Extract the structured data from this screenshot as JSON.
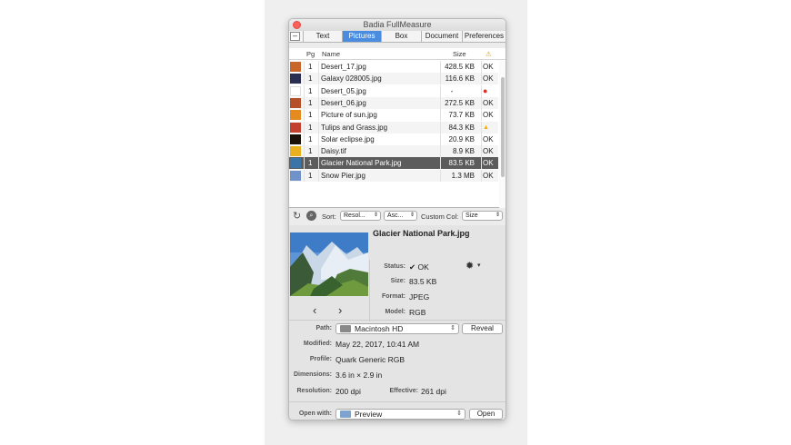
{
  "window": {
    "title": "Badia FullMeasure"
  },
  "tabs": [
    {
      "label": "Text",
      "active": false
    },
    {
      "label": "Pictures",
      "active": true
    },
    {
      "label": "Box",
      "active": false
    },
    {
      "label": "Document",
      "active": false
    },
    {
      "label": "Preferences",
      "active": false
    }
  ],
  "list": {
    "columns": {
      "pg": "Pg",
      "name": "Name",
      "size": "Size",
      "status": "⚠"
    },
    "rows": [
      {
        "pg": "1",
        "name": "Desert_17.jpg",
        "size": "428.5 KB",
        "status": "OK",
        "thumb": "#c9662a"
      },
      {
        "pg": "1",
        "name": "Galaxy 028005.jpg",
        "size": "116.6 KB",
        "status": "OK",
        "thumb": "#2a2f52"
      },
      {
        "pg": "1",
        "name": "Desert_05.jpg",
        "size": "-",
        "status": "●",
        "thumb": "#ffffff"
      },
      {
        "pg": "1",
        "name": "Desert_06.jpg",
        "size": "272.5 KB",
        "status": "OK",
        "thumb": "#b5502a"
      },
      {
        "pg": "1",
        "name": "Picture of sun.jpg",
        "size": "73.7 KB",
        "status": "OK",
        "thumb": "#e58a1e"
      },
      {
        "pg": "1",
        "name": "Tulips and Grass.jpg",
        "size": "84.3 KB",
        "status": "▲",
        "thumb": "#c2412f"
      },
      {
        "pg": "1",
        "name": "Solar eclipse.jpg",
        "size": "20.9 KB",
        "status": "OK",
        "thumb": "#1a1208"
      },
      {
        "pg": "1",
        "name": "Daisy.tif",
        "size": "8.9 KB",
        "status": "OK",
        "thumb": "#e9b020"
      },
      {
        "pg": "1",
        "name": "Glacier National Park.jpg",
        "size": "83.5 KB",
        "status": "OK",
        "thumb": "#3b75a8"
      },
      {
        "pg": "1",
        "name": "Snow Pier.jpg",
        "size": "1.3 MB",
        "status": "OK",
        "thumb": "#6f93c8"
      }
    ],
    "selected_index": 8
  },
  "toolbar": {
    "sort_label": "Sort:",
    "sort_value": "Resol...",
    "order_value": "Asc...",
    "custom_col_label": "Custom Col:",
    "custom_col_value": "Size"
  },
  "detail": {
    "file_name": "Glacier National Park.jpg",
    "status_label": "Status:",
    "status_value": "✔ OK",
    "size_label": "Size:",
    "size_value": "83.5 KB",
    "format_label": "Format:",
    "format_value": "JPEG",
    "model_label": "Model:",
    "model_value": "RGB",
    "path_label": "Path:",
    "path_value": "Macintosh HD",
    "reveal_button": "Reveal",
    "modified_label": "Modified:",
    "modified_value": "May 22, 2017, 10:41 AM",
    "profile_label": "Profile:",
    "profile_value": "Quark Generic RGB",
    "dimensions_label": "Dimensions:",
    "dimensions_value": "3.6 in × 2.9 in",
    "resolution_label": "Resolution:",
    "resolution_value": "200 dpi",
    "effective_label": "Effective:",
    "effective_value": "261 dpi",
    "open_with_label": "Open with:",
    "open_with_value": "Preview",
    "open_button": "Open"
  },
  "colors": {
    "accent": "#4a8de0",
    "selected_row": "#5c5c5c",
    "close_button": "#fc605c",
    "error": "#d6302a",
    "warning": "#f0b400"
  }
}
